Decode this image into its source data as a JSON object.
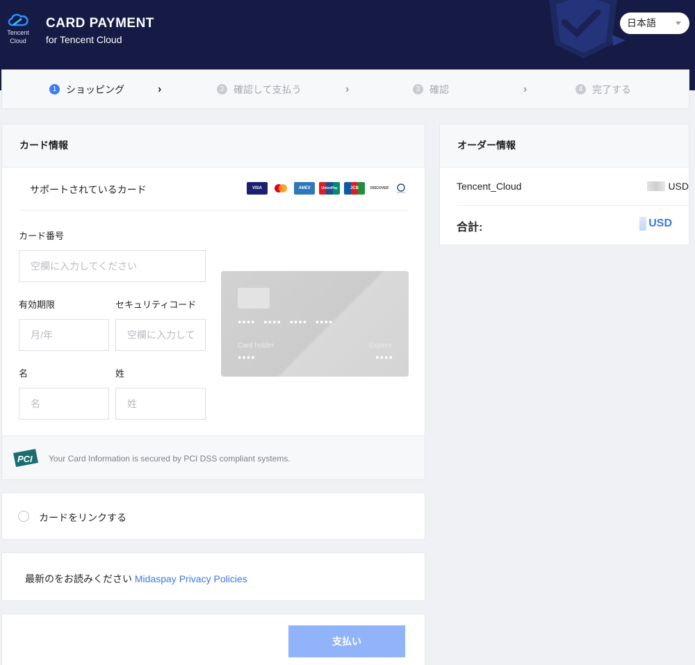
{
  "header": {
    "logo_text_line1": "Tencent",
    "logo_text_line2": "Cloud",
    "title": "CARD PAYMENT",
    "subtitle": "for Tencent Cloud",
    "language": "日本語"
  },
  "steps": [
    {
      "num": "1",
      "label": "ショッピング"
    },
    {
      "num": "2",
      "label": "確認して支払う"
    },
    {
      "num": "3",
      "label": "確認"
    },
    {
      "num": "4",
      "label": "完了する"
    }
  ],
  "card_info": {
    "heading": "カード情報",
    "supported_label": "サポートされているカード",
    "brands": [
      "VISA",
      "Mastercard",
      "AMEX",
      "UnionPay",
      "JCB",
      "DISCOVER",
      "Diners Club"
    ],
    "card_number": {
      "label": "カード番号",
      "placeholder": "空欄に入力してください"
    },
    "expiry": {
      "label": "有効期限",
      "placeholder": "月/年"
    },
    "security_code": {
      "label": "セキュリティコード",
      "placeholder": "空欄に入力してください"
    },
    "first_name": {
      "label": "名",
      "placeholder": "名"
    },
    "last_name": {
      "label": "姓",
      "placeholder": "姓"
    },
    "card_preview": {
      "number_mask": "●●●● ●●●● ●●●● ●●●●",
      "holder_label": "Card holder",
      "expires_label": "Expires",
      "holder_mask": "●●●●",
      "expires_mask": "●●●●"
    },
    "pci_text": "Your Card Information is secured by PCI DSS compliant systems.",
    "pci_logo": "PCI"
  },
  "link_card": {
    "label": "カードをリンクする"
  },
  "privacy": {
    "prefix": "最新のをお読みください",
    "link": "Midaspay Privacy Policies"
  },
  "pay_button": "支払い",
  "order": {
    "heading": "オーダー情報",
    "item": "Tencent_Cloud",
    "item_currency": "USD",
    "total_label": "合計:",
    "total_currency": "USD"
  },
  "colors": {
    "header_bg": "#151b45",
    "accent": "#3b78e7",
    "pay_button": "#91b3fa"
  }
}
